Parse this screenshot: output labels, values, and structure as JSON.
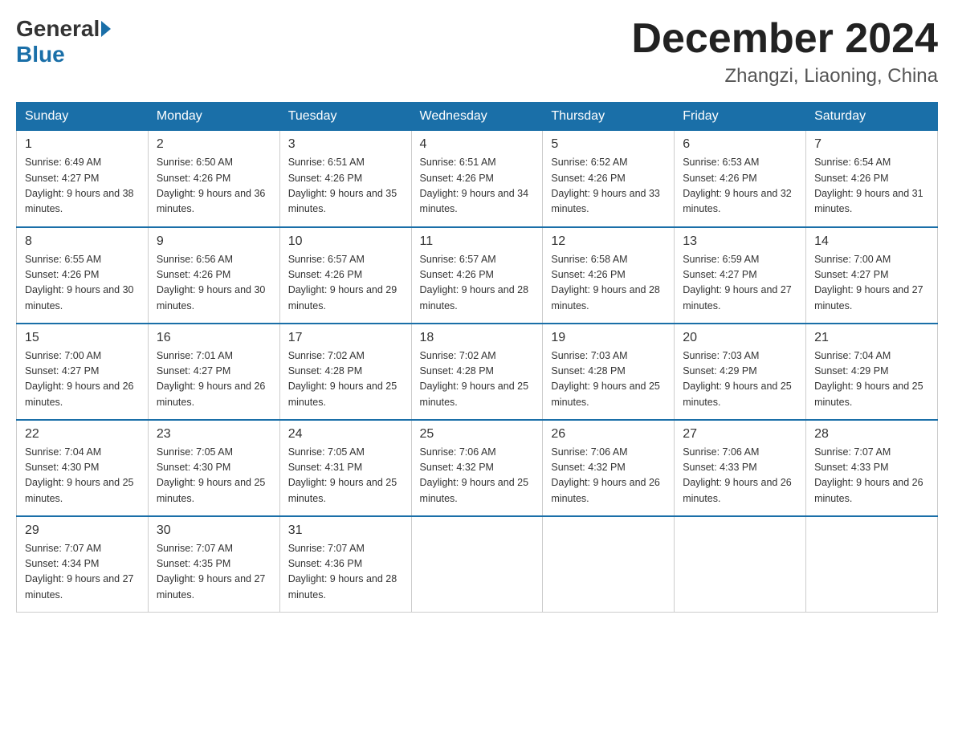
{
  "logo": {
    "general": "General",
    "blue": "Blue"
  },
  "title": "December 2024",
  "location": "Zhangzi, Liaoning, China",
  "days_of_week": [
    "Sunday",
    "Monday",
    "Tuesday",
    "Wednesday",
    "Thursday",
    "Friday",
    "Saturday"
  ],
  "weeks": [
    [
      {
        "day": "1",
        "sunrise": "6:49 AM",
        "sunset": "4:27 PM",
        "daylight": "9 hours and 38 minutes."
      },
      {
        "day": "2",
        "sunrise": "6:50 AM",
        "sunset": "4:26 PM",
        "daylight": "9 hours and 36 minutes."
      },
      {
        "day": "3",
        "sunrise": "6:51 AM",
        "sunset": "4:26 PM",
        "daylight": "9 hours and 35 minutes."
      },
      {
        "day": "4",
        "sunrise": "6:51 AM",
        "sunset": "4:26 PM",
        "daylight": "9 hours and 34 minutes."
      },
      {
        "day": "5",
        "sunrise": "6:52 AM",
        "sunset": "4:26 PM",
        "daylight": "9 hours and 33 minutes."
      },
      {
        "day": "6",
        "sunrise": "6:53 AM",
        "sunset": "4:26 PM",
        "daylight": "9 hours and 32 minutes."
      },
      {
        "day": "7",
        "sunrise": "6:54 AM",
        "sunset": "4:26 PM",
        "daylight": "9 hours and 31 minutes."
      }
    ],
    [
      {
        "day": "8",
        "sunrise": "6:55 AM",
        "sunset": "4:26 PM",
        "daylight": "9 hours and 30 minutes."
      },
      {
        "day": "9",
        "sunrise": "6:56 AM",
        "sunset": "4:26 PM",
        "daylight": "9 hours and 30 minutes."
      },
      {
        "day": "10",
        "sunrise": "6:57 AM",
        "sunset": "4:26 PM",
        "daylight": "9 hours and 29 minutes."
      },
      {
        "day": "11",
        "sunrise": "6:57 AM",
        "sunset": "4:26 PM",
        "daylight": "9 hours and 28 minutes."
      },
      {
        "day": "12",
        "sunrise": "6:58 AM",
        "sunset": "4:26 PM",
        "daylight": "9 hours and 28 minutes."
      },
      {
        "day": "13",
        "sunrise": "6:59 AM",
        "sunset": "4:27 PM",
        "daylight": "9 hours and 27 minutes."
      },
      {
        "day": "14",
        "sunrise": "7:00 AM",
        "sunset": "4:27 PM",
        "daylight": "9 hours and 27 minutes."
      }
    ],
    [
      {
        "day": "15",
        "sunrise": "7:00 AM",
        "sunset": "4:27 PM",
        "daylight": "9 hours and 26 minutes."
      },
      {
        "day": "16",
        "sunrise": "7:01 AM",
        "sunset": "4:27 PM",
        "daylight": "9 hours and 26 minutes."
      },
      {
        "day": "17",
        "sunrise": "7:02 AM",
        "sunset": "4:28 PM",
        "daylight": "9 hours and 25 minutes."
      },
      {
        "day": "18",
        "sunrise": "7:02 AM",
        "sunset": "4:28 PM",
        "daylight": "9 hours and 25 minutes."
      },
      {
        "day": "19",
        "sunrise": "7:03 AM",
        "sunset": "4:28 PM",
        "daylight": "9 hours and 25 minutes."
      },
      {
        "day": "20",
        "sunrise": "7:03 AM",
        "sunset": "4:29 PM",
        "daylight": "9 hours and 25 minutes."
      },
      {
        "day": "21",
        "sunrise": "7:04 AM",
        "sunset": "4:29 PM",
        "daylight": "9 hours and 25 minutes."
      }
    ],
    [
      {
        "day": "22",
        "sunrise": "7:04 AM",
        "sunset": "4:30 PM",
        "daylight": "9 hours and 25 minutes."
      },
      {
        "day": "23",
        "sunrise": "7:05 AM",
        "sunset": "4:30 PM",
        "daylight": "9 hours and 25 minutes."
      },
      {
        "day": "24",
        "sunrise": "7:05 AM",
        "sunset": "4:31 PM",
        "daylight": "9 hours and 25 minutes."
      },
      {
        "day": "25",
        "sunrise": "7:06 AM",
        "sunset": "4:32 PM",
        "daylight": "9 hours and 25 minutes."
      },
      {
        "day": "26",
        "sunrise": "7:06 AM",
        "sunset": "4:32 PM",
        "daylight": "9 hours and 26 minutes."
      },
      {
        "day": "27",
        "sunrise": "7:06 AM",
        "sunset": "4:33 PM",
        "daylight": "9 hours and 26 minutes."
      },
      {
        "day": "28",
        "sunrise": "7:07 AM",
        "sunset": "4:33 PM",
        "daylight": "9 hours and 26 minutes."
      }
    ],
    [
      {
        "day": "29",
        "sunrise": "7:07 AM",
        "sunset": "4:34 PM",
        "daylight": "9 hours and 27 minutes."
      },
      {
        "day": "30",
        "sunrise": "7:07 AM",
        "sunset": "4:35 PM",
        "daylight": "9 hours and 27 minutes."
      },
      {
        "day": "31",
        "sunrise": "7:07 AM",
        "sunset": "4:36 PM",
        "daylight": "9 hours and 28 minutes."
      },
      null,
      null,
      null,
      null
    ]
  ]
}
